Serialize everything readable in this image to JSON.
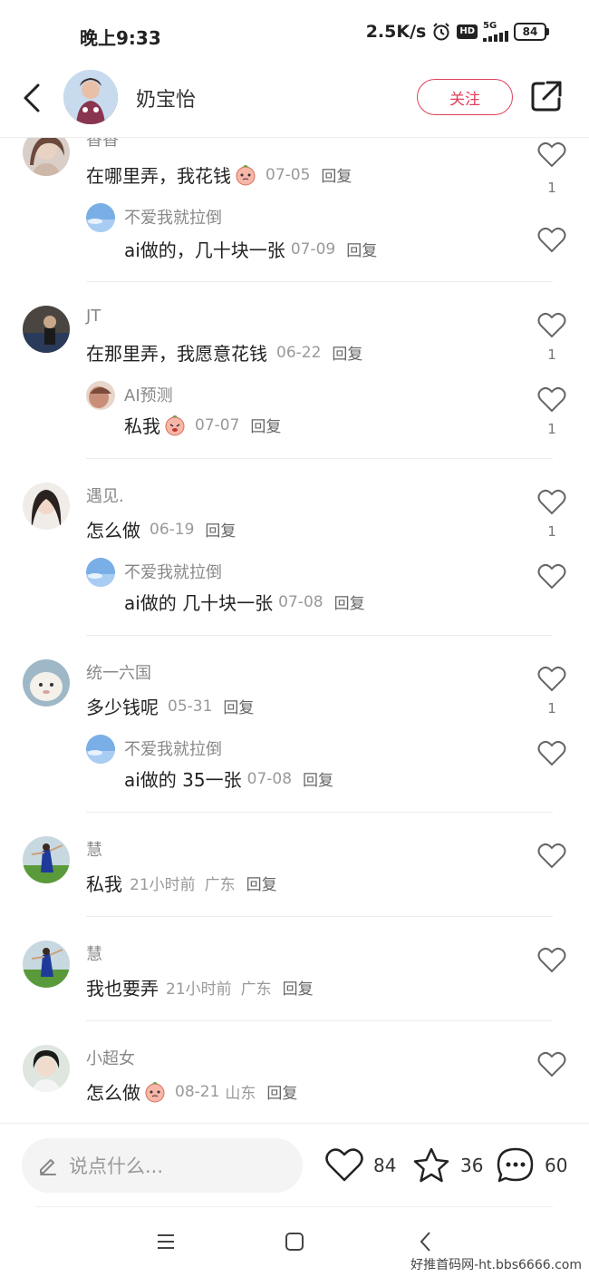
{
  "status": {
    "time": "晚上9:33",
    "speed": "2.5K/s",
    "hd": "HD",
    "network": "5G",
    "battery": "84"
  },
  "header": {
    "author": "奶宝怡",
    "follow_label": "关注"
  },
  "reply_label": "回复",
  "threads": [
    {
      "user": "香香",
      "text": "在哪里弄，我花钱",
      "date": "07-05",
      "likes": "1",
      "reply": {
        "user": "不爱我就拉倒",
        "text": "ai做的，几十块一张",
        "date": "07-09"
      }
    },
    {
      "user": "JT",
      "text": "在那里弄，我愿意花钱",
      "date": "06-22",
      "likes": "1",
      "reply": {
        "user": "AI预测",
        "text": "私我",
        "date": "07-07",
        "likes": "1"
      }
    },
    {
      "user": "遇见.",
      "text": "怎么做",
      "date": "06-19",
      "likes": "1",
      "reply": {
        "user": "不爱我就拉倒",
        "text": "ai做的 几十块一张",
        "date": "07-08"
      }
    },
    {
      "user": "统一六国",
      "text": "多少钱呢",
      "date": "05-31",
      "likes": "1",
      "reply": {
        "user": "不爱我就拉倒",
        "text": "ai做的 35一张",
        "date": "07-08"
      }
    },
    {
      "user": "慧",
      "text": "私我",
      "date": "21小时前",
      "location": "广东"
    },
    {
      "user": "慧",
      "text": "我也要弄",
      "date": "21小时前",
      "location": "广东"
    },
    {
      "user": "小超女",
      "text": "怎么做",
      "date": "08-21",
      "location": "山东"
    }
  ],
  "bottom": {
    "placeholder": "说点什么...",
    "likes": "84",
    "stars": "36",
    "comments": "60"
  },
  "watermark": "好推首码网-ht.bbs6666.com",
  "colors": {
    "accent": "#e0405a"
  }
}
